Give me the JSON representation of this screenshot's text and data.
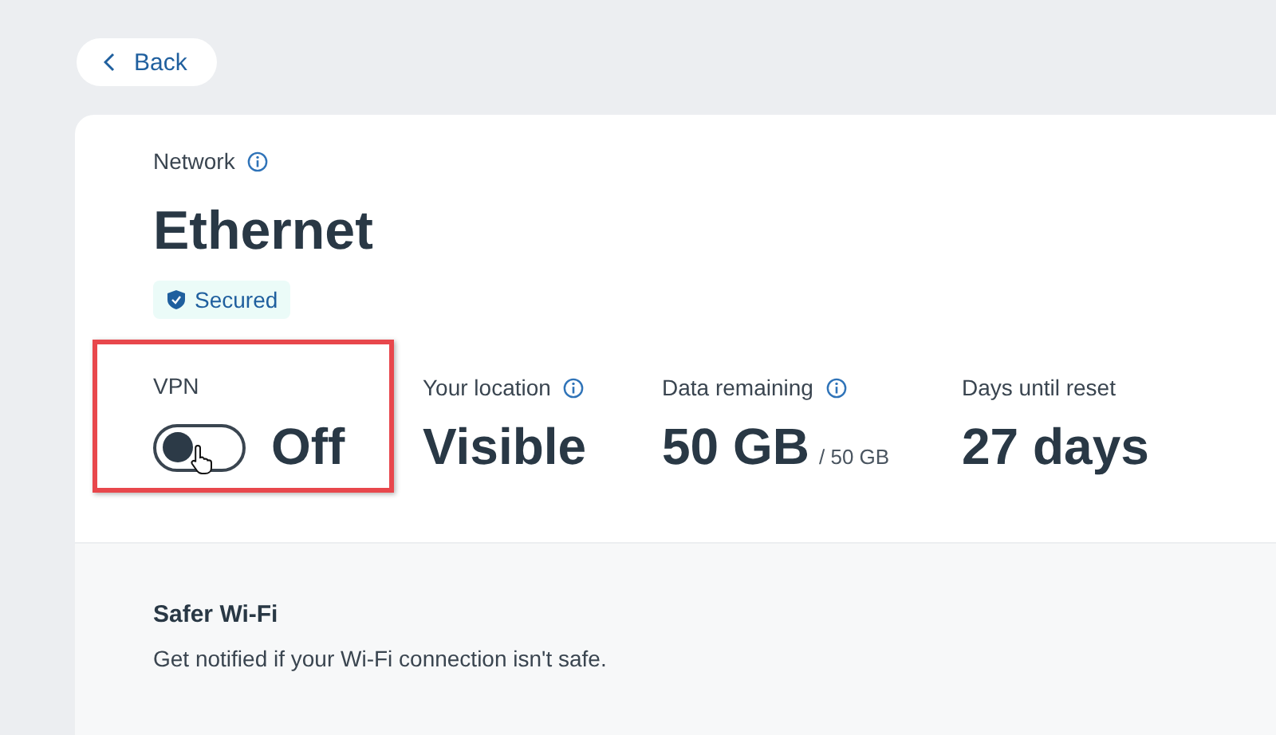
{
  "back_button": {
    "label": "Back"
  },
  "network": {
    "label": "Network",
    "name": "Ethernet",
    "badge": "Secured"
  },
  "vpn": {
    "label": "VPN",
    "on": false,
    "state_text": "Off"
  },
  "stats": [
    {
      "label": "Your location",
      "info": true,
      "value": "Visible"
    },
    {
      "label": "Data remaining",
      "info": true,
      "value": "50 GB",
      "total": "/ 50 GB"
    },
    {
      "label": "Days until reset",
      "info": false,
      "value": "27 days"
    }
  ],
  "safer_wifi": {
    "title": "Safer Wi-Fi",
    "description": "Get notified if your Wi-Fi connection isn't safe."
  }
}
